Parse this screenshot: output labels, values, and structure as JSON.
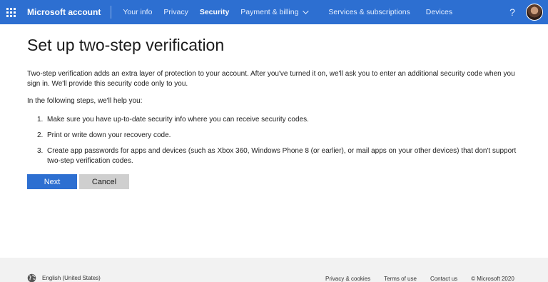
{
  "header": {
    "brand": "Microsoft account",
    "nav": [
      {
        "label": "Your info"
      },
      {
        "label": "Privacy"
      },
      {
        "label": "Security"
      },
      {
        "label": "Payment & billing"
      },
      {
        "label": "Services & subscriptions"
      },
      {
        "label": "Devices"
      }
    ],
    "active_nav": "Security",
    "help_label": "?",
    "accent_color": "#2d6fd1"
  },
  "main": {
    "title": "Set up two-step verification",
    "intro": "Two-step verification adds an extra layer of protection to your account. After you've turned it on, we'll ask you to enter an additional security code when you sign in. We'll provide this security code only to you.",
    "lead": "In the following steps, we'll help you:",
    "steps": [
      {
        "num": "1.",
        "text": "Make sure you have up-to-date security info where you can receive security codes."
      },
      {
        "num": "2.",
        "text": "Print or write down your recovery code."
      },
      {
        "num": "3.",
        "text": "Create app passwords for apps and devices (such as Xbox 360, Windows Phone 8 (or earlier), or mail apps on your other devices) that don't support two-step verification codes."
      }
    ],
    "next_label": "Next",
    "cancel_label": "Cancel"
  },
  "footer": {
    "language": "English (United States)",
    "links": [
      "Privacy & cookies",
      "Terms of use",
      "Contact us"
    ],
    "copyright": "© Microsoft 2020"
  }
}
